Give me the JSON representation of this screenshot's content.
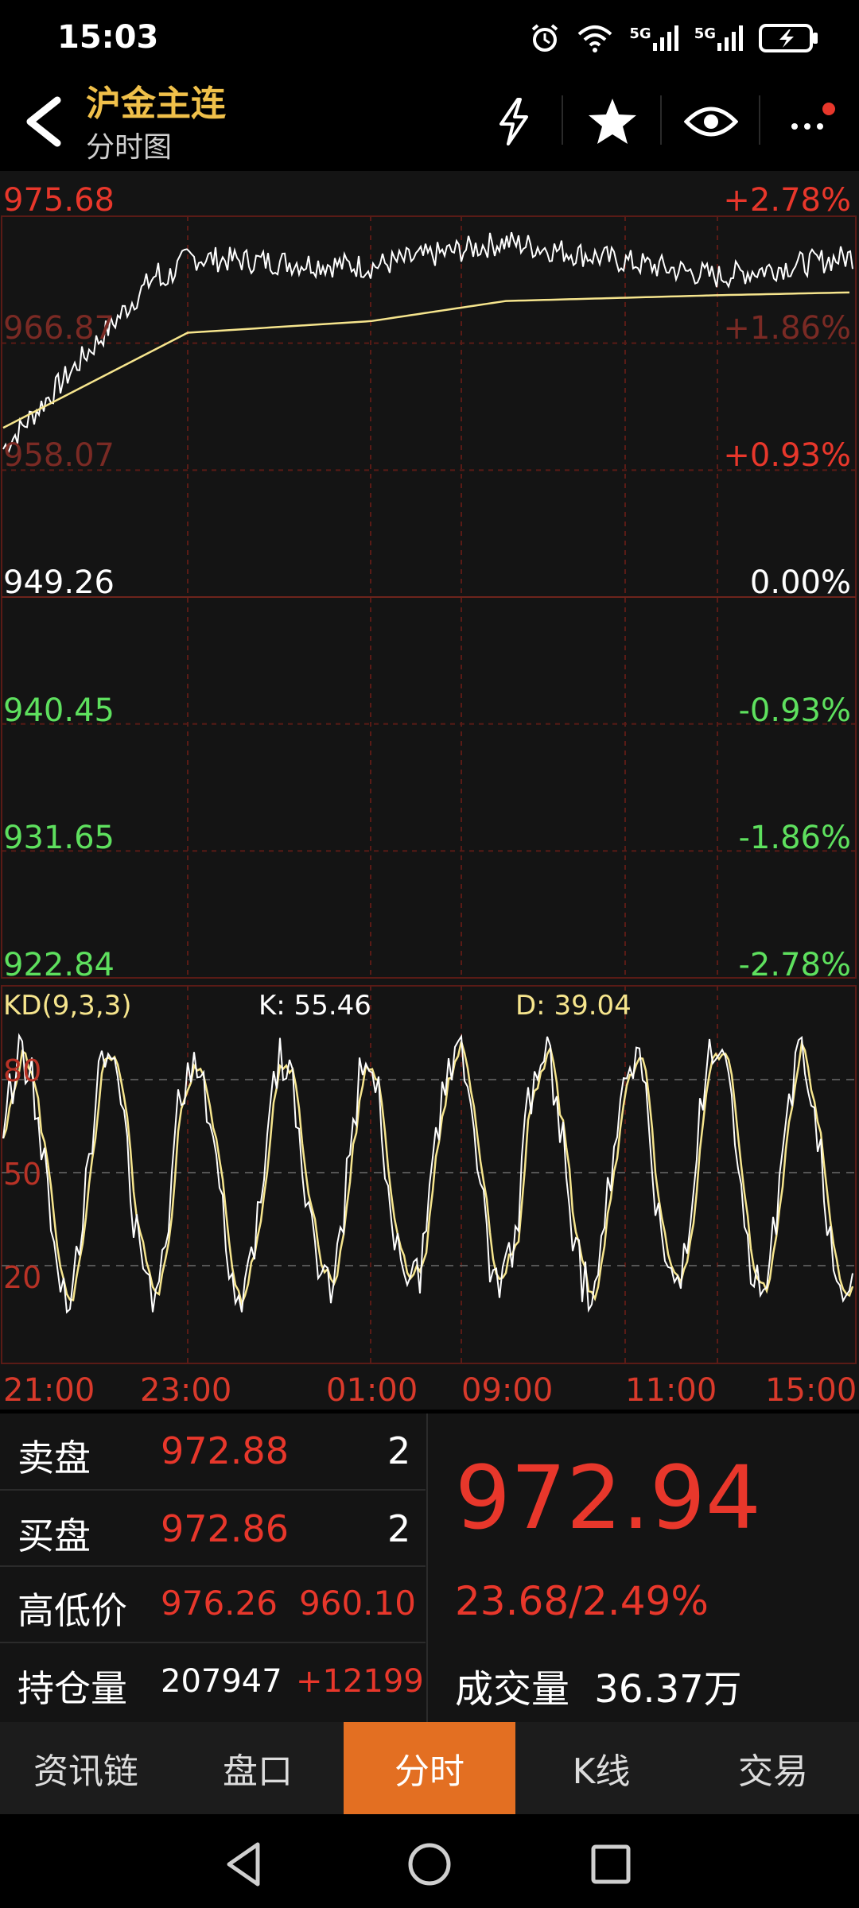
{
  "status": {
    "time": "15:03",
    "icons": [
      "alarm-icon",
      "wifi-icon",
      "5g-signal-icon",
      "5g-signal-icon",
      "battery-charging-icon"
    ],
    "signal_label_1": "5G",
    "signal_label_2": "5G"
  },
  "header": {
    "title": "沪金主连",
    "subtitle": "分时图",
    "actions": [
      "flash-icon",
      "star-icon",
      "eye-icon",
      "more-icon"
    ]
  },
  "chart": {
    "price_labels": [
      "975.68",
      "966.87",
      "958.07",
      "949.26",
      "940.45",
      "931.65",
      "922.84"
    ],
    "pct_labels": [
      "+2.78%",
      "+1.86%",
      "+0.93%",
      "0.00%",
      "-0.93%",
      "-1.86%",
      "-2.78%"
    ],
    "kd_title": "KD(9,3,3)",
    "k_value": "K: 55.46",
    "d_value": "D: 39.04",
    "kd_levels": [
      "80",
      "50",
      "20"
    ],
    "time_labels": [
      "21:00",
      "23:00",
      "01:00",
      "09:00",
      "11:00",
      "15:00"
    ],
    "colors": {
      "up": "#e8372b",
      "down": "#5ee05e",
      "neutral": "#ffffff",
      "avg_line": "#f6e58d",
      "grid": "#5a1b16"
    }
  },
  "chart_data": {
    "type": "line",
    "x": [
      "21:00",
      "23:00",
      "01:00",
      "09:00",
      "11:00",
      "15:00"
    ],
    "series": [
      {
        "values": [
          960.5,
          972.8,
          972.2,
          973.9,
          971.5,
          972.9
        ]
      },
      {
        "values": [
          961.0,
          967.6,
          968.4,
          969.8,
          970.2,
          970.4
        ]
      }
    ],
    "ylim": [
      922.84,
      975.68
    ],
    "kd": {
      "k": 55.46,
      "d": 39.04,
      "levels": [
        20,
        50,
        80
      ]
    }
  },
  "quote": {
    "sell_label": "卖盘",
    "sell_price": "972.88",
    "sell_qty": "2",
    "buy_label": "买盘",
    "buy_price": "972.86",
    "buy_qty": "2",
    "hilo_label": "高低价",
    "high": "976.26",
    "low": "960.10",
    "oi_label": "持仓量",
    "open_interest": "207947",
    "oi_change": "+12199",
    "last_price": "972.94",
    "change": "23.68/2.49%",
    "volume_label": "成交量",
    "volume": "36.37万"
  },
  "tabs": [
    {
      "label": "资讯链"
    },
    {
      "label": "盘口"
    },
    {
      "label": "分时",
      "active": true
    },
    {
      "label": "K线"
    },
    {
      "label": "交易"
    }
  ],
  "nav": [
    "back-triangle-icon",
    "home-circle-icon",
    "recents-square-icon"
  ]
}
